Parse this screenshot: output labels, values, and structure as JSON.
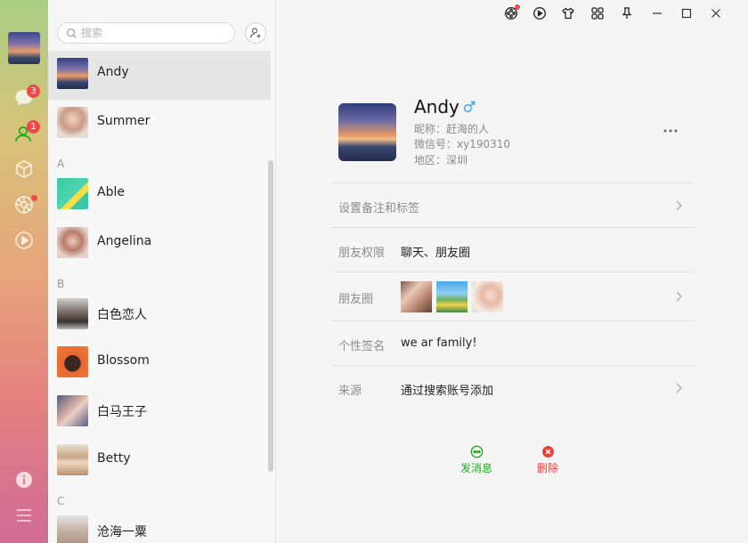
{
  "search": {
    "placeholder": "搜索"
  },
  "rail": {
    "badges": {
      "chat": "3",
      "contacts": "1"
    }
  },
  "contacts": {
    "pinned": [
      {
        "name": "Andy"
      },
      {
        "name": "Summer"
      }
    ],
    "groups": [
      {
        "letter": "A",
        "items": [
          {
            "name": "Able"
          },
          {
            "name": "Angelina"
          }
        ]
      },
      {
        "letter": "B",
        "items": [
          {
            "name": "白色恋人"
          },
          {
            "name": "Blossom"
          },
          {
            "name": "白马王子"
          },
          {
            "name": "Betty"
          }
        ]
      },
      {
        "letter": "C",
        "items": [
          {
            "name": "沧海一粟"
          }
        ]
      }
    ]
  },
  "profile": {
    "name": "Andy",
    "nickname_line": "昵称：赶海的人",
    "wechat_id_line": "微信号：xy190310",
    "region_line": "地区：深圳"
  },
  "rows": {
    "remark": {
      "label": "设置备注和标签"
    },
    "permissions": {
      "label": "朋友权限",
      "value": "聊天、朋友圈"
    },
    "moments": {
      "label": "朋友圈"
    },
    "signature": {
      "label": "个性签名",
      "value": "we ar family!"
    },
    "source": {
      "label": "来源",
      "value": "通过搜索账号添加"
    }
  },
  "actions": {
    "message": {
      "label": "发消息"
    },
    "delete": {
      "label": "删除"
    }
  },
  "colors": {
    "accent_green": "#1aad19",
    "delete_red": "#e64340",
    "badge_red": "#f04848",
    "male_blue": "#4aa3e6"
  }
}
